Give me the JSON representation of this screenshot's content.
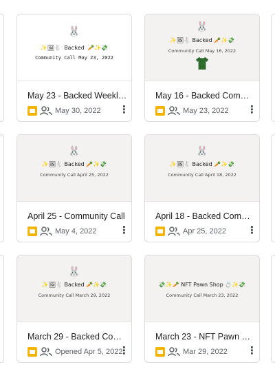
{
  "cards": [
    {
      "title": "May 23 - Backed Weekly ...",
      "date": "May 30, 2022",
      "thumb": {
        "line": "✨🖼🐇 Backed 🥕✨💸",
        "sub": "Community Call May 23, 2022"
      }
    },
    {
      "title": "May 16 - Backed Commu...",
      "date": "May 23, 2022",
      "thumb": {
        "line": "✨🖼🐇 Backed 🥕✨💸",
        "sub": "Community Call May 16, 2022"
      }
    },
    {
      "title": "April 25 - Community Call",
      "date": "May 4, 2022",
      "thumb": {
        "line": "✨🖼🐇 Backed 🥕✨💸",
        "sub": "Community Call April 25, 2022"
      }
    },
    {
      "title": "April 18 - Backed Commu...",
      "date": "Apr 25, 2022",
      "thumb": {
        "line": "✨🖼🐇 Backed 🥕✨💸",
        "sub": "Community Call April 18, 2022"
      }
    },
    {
      "title": "March 29 - Backed Com...",
      "date": "Opened Apr 5, 2022",
      "thumb": {
        "line": "✨🖼🐇 Backed 🥕✨💸",
        "sub": "Community Call March 29, 2022"
      }
    },
    {
      "title": "March 23 - NFT Pawn Sh...",
      "date": "Mar 29, 2022",
      "thumb": {
        "line": "💸✨🥕 NFT Pawn Shop 💍✨💸",
        "sub": "Community Call March 23, 2022"
      }
    }
  ],
  "icons": {
    "file_type": "slides-icon",
    "shared": "shared-people-icon",
    "more": "more-vert-icon",
    "bunny": "bunny-icon"
  },
  "colors": {
    "slides": "#f4b400",
    "border": "#dadce0"
  }
}
